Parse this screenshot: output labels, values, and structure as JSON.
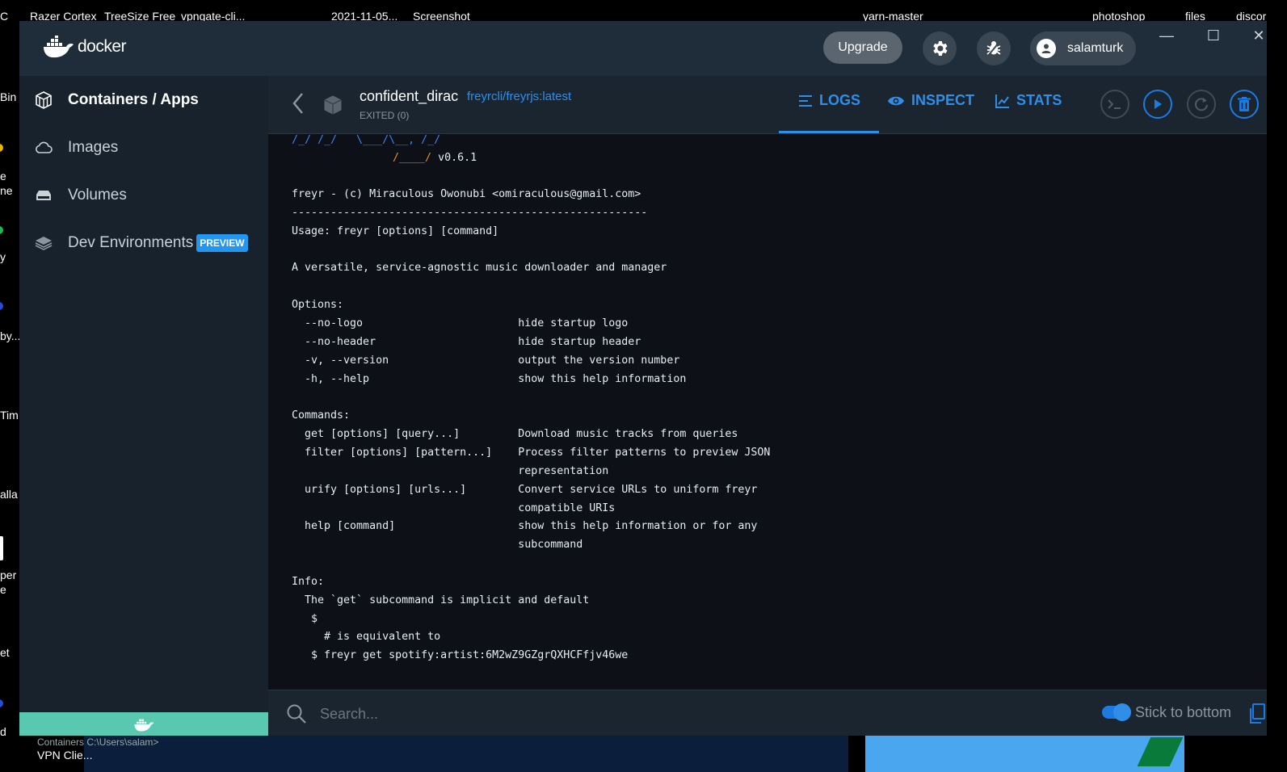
{
  "desktop": {
    "icons": [
      "Razer Cortex",
      "TreeSize Free",
      "vpngate-cli...",
      "2021-11-05...",
      "Screenshot",
      "yarn-master",
      "photoshop",
      "files",
      "discor"
    ],
    "left_edge": [
      "C",
      "Bin",
      "e",
      "ne",
      "y",
      "by...",
      "Tim",
      "alla",
      "per",
      "e",
      "et",
      "d"
    ],
    "taskbar_text": [
      "Containers  C:\\Users\\salam>",
      "VPN Clie..."
    ]
  },
  "app": {
    "name": "docker",
    "upgrade_label": "Upgrade",
    "user": "salamturk",
    "window_controls": [
      "—",
      "☐",
      "✕"
    ]
  },
  "sidebar": {
    "items": [
      {
        "label": "Containers / Apps",
        "icon": "containers-icon",
        "active": true
      },
      {
        "label": "Images",
        "icon": "cloud-icon",
        "active": false
      },
      {
        "label": "Volumes",
        "icon": "volume-icon",
        "active": false
      },
      {
        "label": "Dev Environments",
        "icon": "dev-env-icon",
        "active": false,
        "badge": "PREVIEW"
      }
    ]
  },
  "container": {
    "name": "confident_dirac",
    "image": "freyrcli/freyrjs:latest",
    "status": "EXITED (0)"
  },
  "tabs": [
    {
      "label": "LOGS",
      "icon": "list-icon",
      "active": true
    },
    {
      "label": "INSPECT",
      "icon": "eye-icon",
      "active": false
    },
    {
      "label": "STATS",
      "icon": "chart-icon",
      "active": false
    }
  ],
  "logs": {
    "logo_line1": "/_/ /_/   \\___/\\__, /_/",
    "logo_line2": "/____/",
    "version": "v0.6.1",
    "lines": [
      "freyr - (c) Miraculous Owonubi <omiraculous@gmail.com>",
      "-------------------------------------------------------",
      "Usage: freyr [options] [command]",
      "",
      "A versatile, service-agnostic music downloader and manager",
      "",
      "Options:",
      "  --no-logo                        hide startup logo",
      "  --no-header                      hide startup header",
      "  -v, --version                    output the version number",
      "  -h, --help                       show this help information",
      "",
      "Commands:",
      "  get [options] [query...]         Download music tracks from queries",
      "  filter [options] [pattern...]    Process filter patterns to preview JSON",
      "                                   representation",
      "  urify [options] [urls...]        Convert service URLs to uniform freyr",
      "                                   compatible URIs",
      "  help [command]                   show this help information or for any",
      "                                   subcommand",
      "",
      "Info:",
      "  The `get` subcommand is implicit and default",
      "   $ ",
      "     # is equivalent to",
      "   $ freyr get spotify:artist:6M2wZ9GZgrQXHCFfjv46we"
    ],
    "highlighted": "freyr spotify:artist:6M2wZ9GZgrQXHCFfjv46we"
  },
  "footer": {
    "search_placeholder": "Search...",
    "stick_label": "Stick to bottom",
    "stick_on": true
  }
}
